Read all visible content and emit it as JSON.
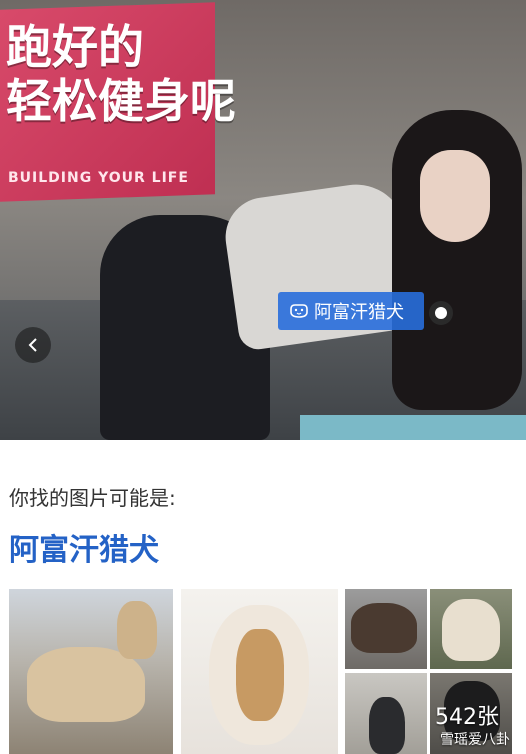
{
  "hero": {
    "banner_text": "跑好的\n轻松健身呢",
    "banner_small": "BUILDING YOUR LIFE",
    "tag_label": "阿富汗猎犬",
    "tag_icon": "dog-icon",
    "prev_icon": "chevron-left-icon"
  },
  "results": {
    "hint": "你找的图片可能是:",
    "title": "阿富汗猎犬",
    "count": "542张"
  },
  "watermark": "雪瑶爱八卦",
  "colors": {
    "accent": "#2462c6",
    "tag_bg": "#286edc"
  }
}
